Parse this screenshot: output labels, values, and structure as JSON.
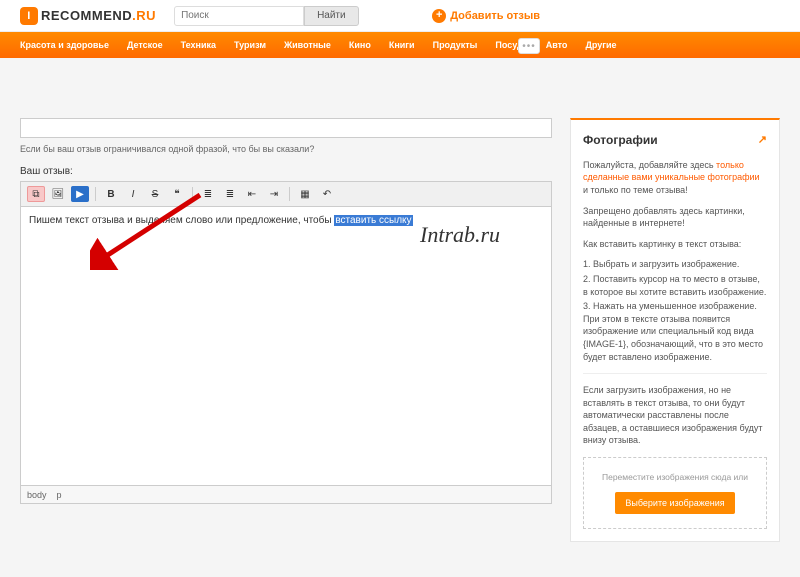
{
  "header": {
    "logo_prefix": "I",
    "logo_main": "RECOMMEND",
    "logo_suffix": ".RU",
    "search_placeholder": "Поиск",
    "search_button": "Найти",
    "add_review": "Добавить отзыв"
  },
  "nav": {
    "items": [
      "Красота и здоровье",
      "Детское",
      "Техника",
      "Туризм",
      "Животные",
      "Кино",
      "Книги",
      "Продукты",
      "Посуда",
      "Авто",
      "Другие"
    ]
  },
  "editor": {
    "hint": "Если бы ваш отзыв ограничивался одной фразой, что бы вы сказали?",
    "label": "Ваш отзыв:",
    "content_plain": "Пишем текст отзыва и выделяем слово или предложение, чтобы ",
    "content_selected": "вставить ссылку",
    "status_body": "body",
    "status_p": "p"
  },
  "toolbar": {
    "icons": {
      "link": "⧉",
      "image": "🖼",
      "video": "▶",
      "bold": "B",
      "italic": "I",
      "strike": "S",
      "quote": "❝",
      "ul": "≣",
      "ol": "≣",
      "outdent": "⇤",
      "indent": "⇥",
      "table": "▦",
      "undo": "↶"
    }
  },
  "sidebar": {
    "title": "Фотографии",
    "p1_a": "Пожалуйста, добавляйте здесь ",
    "p1_hl": "только сделанные вами уникальные фотографии",
    "p1_b": " и только по теме отзыва!",
    "p2": "Запрещено добавлять здесь картинки, найденные в интернете!",
    "howto_title": "Как вставить картинку в текст отзыва:",
    "steps": [
      "Выбрать и загрузить изображение.",
      "Поставить курсор на то место в отзыве, в которое вы хотите вставить изображение.",
      "Нажать на уменьшенное изображение. При этом в тексте отзыва появится изображение или специальный код вида {IMAGE-1}, обозначающий, что в это место будет вставлено изображение."
    ],
    "note": "Если загрузить изображения, но не вставлять в текст отзыва, то они будут автоматически расставлены после абзацев, а оставшиеся изображения будут внизу отзыва.",
    "dropzone_text": "Переместите изображения сюда или",
    "upload_button": "Выберите изображения"
  },
  "watermark": "Intrab.ru"
}
